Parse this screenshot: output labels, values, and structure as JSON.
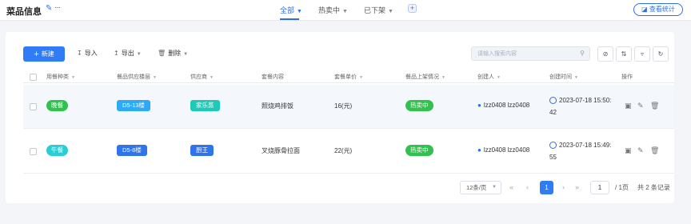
{
  "header": {
    "title": "菜品信息",
    "edit_icon": "edit-icon",
    "more_icon": "more-icon",
    "tabs": [
      {
        "label": "全部",
        "active": true
      },
      {
        "label": "热卖中",
        "active": false
      },
      {
        "label": "已下架",
        "active": false
      }
    ],
    "add_tab_icon": "plus-icon",
    "stats_label": "查看统计"
  },
  "toolbar": {
    "new_label": "新建",
    "import_label": "导入",
    "export_label": "导出",
    "delete_label": "删除",
    "search_placeholder": "请输入搜索内容",
    "search_value": ""
  },
  "table": {
    "columns": [
      "用餐种类",
      "餐品供应楼层",
      "供应商",
      "套餐内容",
      "套餐单价",
      "餐品上架情况",
      "创建人",
      "创建时间",
      "操作"
    ],
    "rows": [
      {
        "meal_type": "晚餐",
        "floor": "D5-13楼",
        "supplier": "家乐蒸",
        "content": "照烧鸡排饭",
        "price": "16(元)",
        "status": "热卖中",
        "creator": "lzz0408 lzz0408",
        "created_date": "2023-07-18 15:50:",
        "created_sec": "42"
      },
      {
        "meal_type": "午餐",
        "floor": "D5-8楼",
        "supplier": "厨王",
        "content": "叉烧豚骨拉面",
        "price": "22(元)",
        "status": "热卖中",
        "creator": "lzz0408 lzz0408",
        "created_date": "2023-07-18 15:49:",
        "created_sec": "55"
      }
    ]
  },
  "pagination": {
    "page_size": "12条/页",
    "current_page": "1",
    "jump_value": "1",
    "total_pages": "/ 1页",
    "total_records": "共 2 条记录"
  },
  "colors": {
    "primary": "#2f7cf6",
    "status_green": "#31c24d",
    "dinner_green": "#31c24d",
    "lunch_cyan": "#2ccdd4",
    "floor_blue": "#2ea9f5",
    "floor_blue_dark": "#2f74e8",
    "supplier_teal": "#1fc9b8"
  }
}
